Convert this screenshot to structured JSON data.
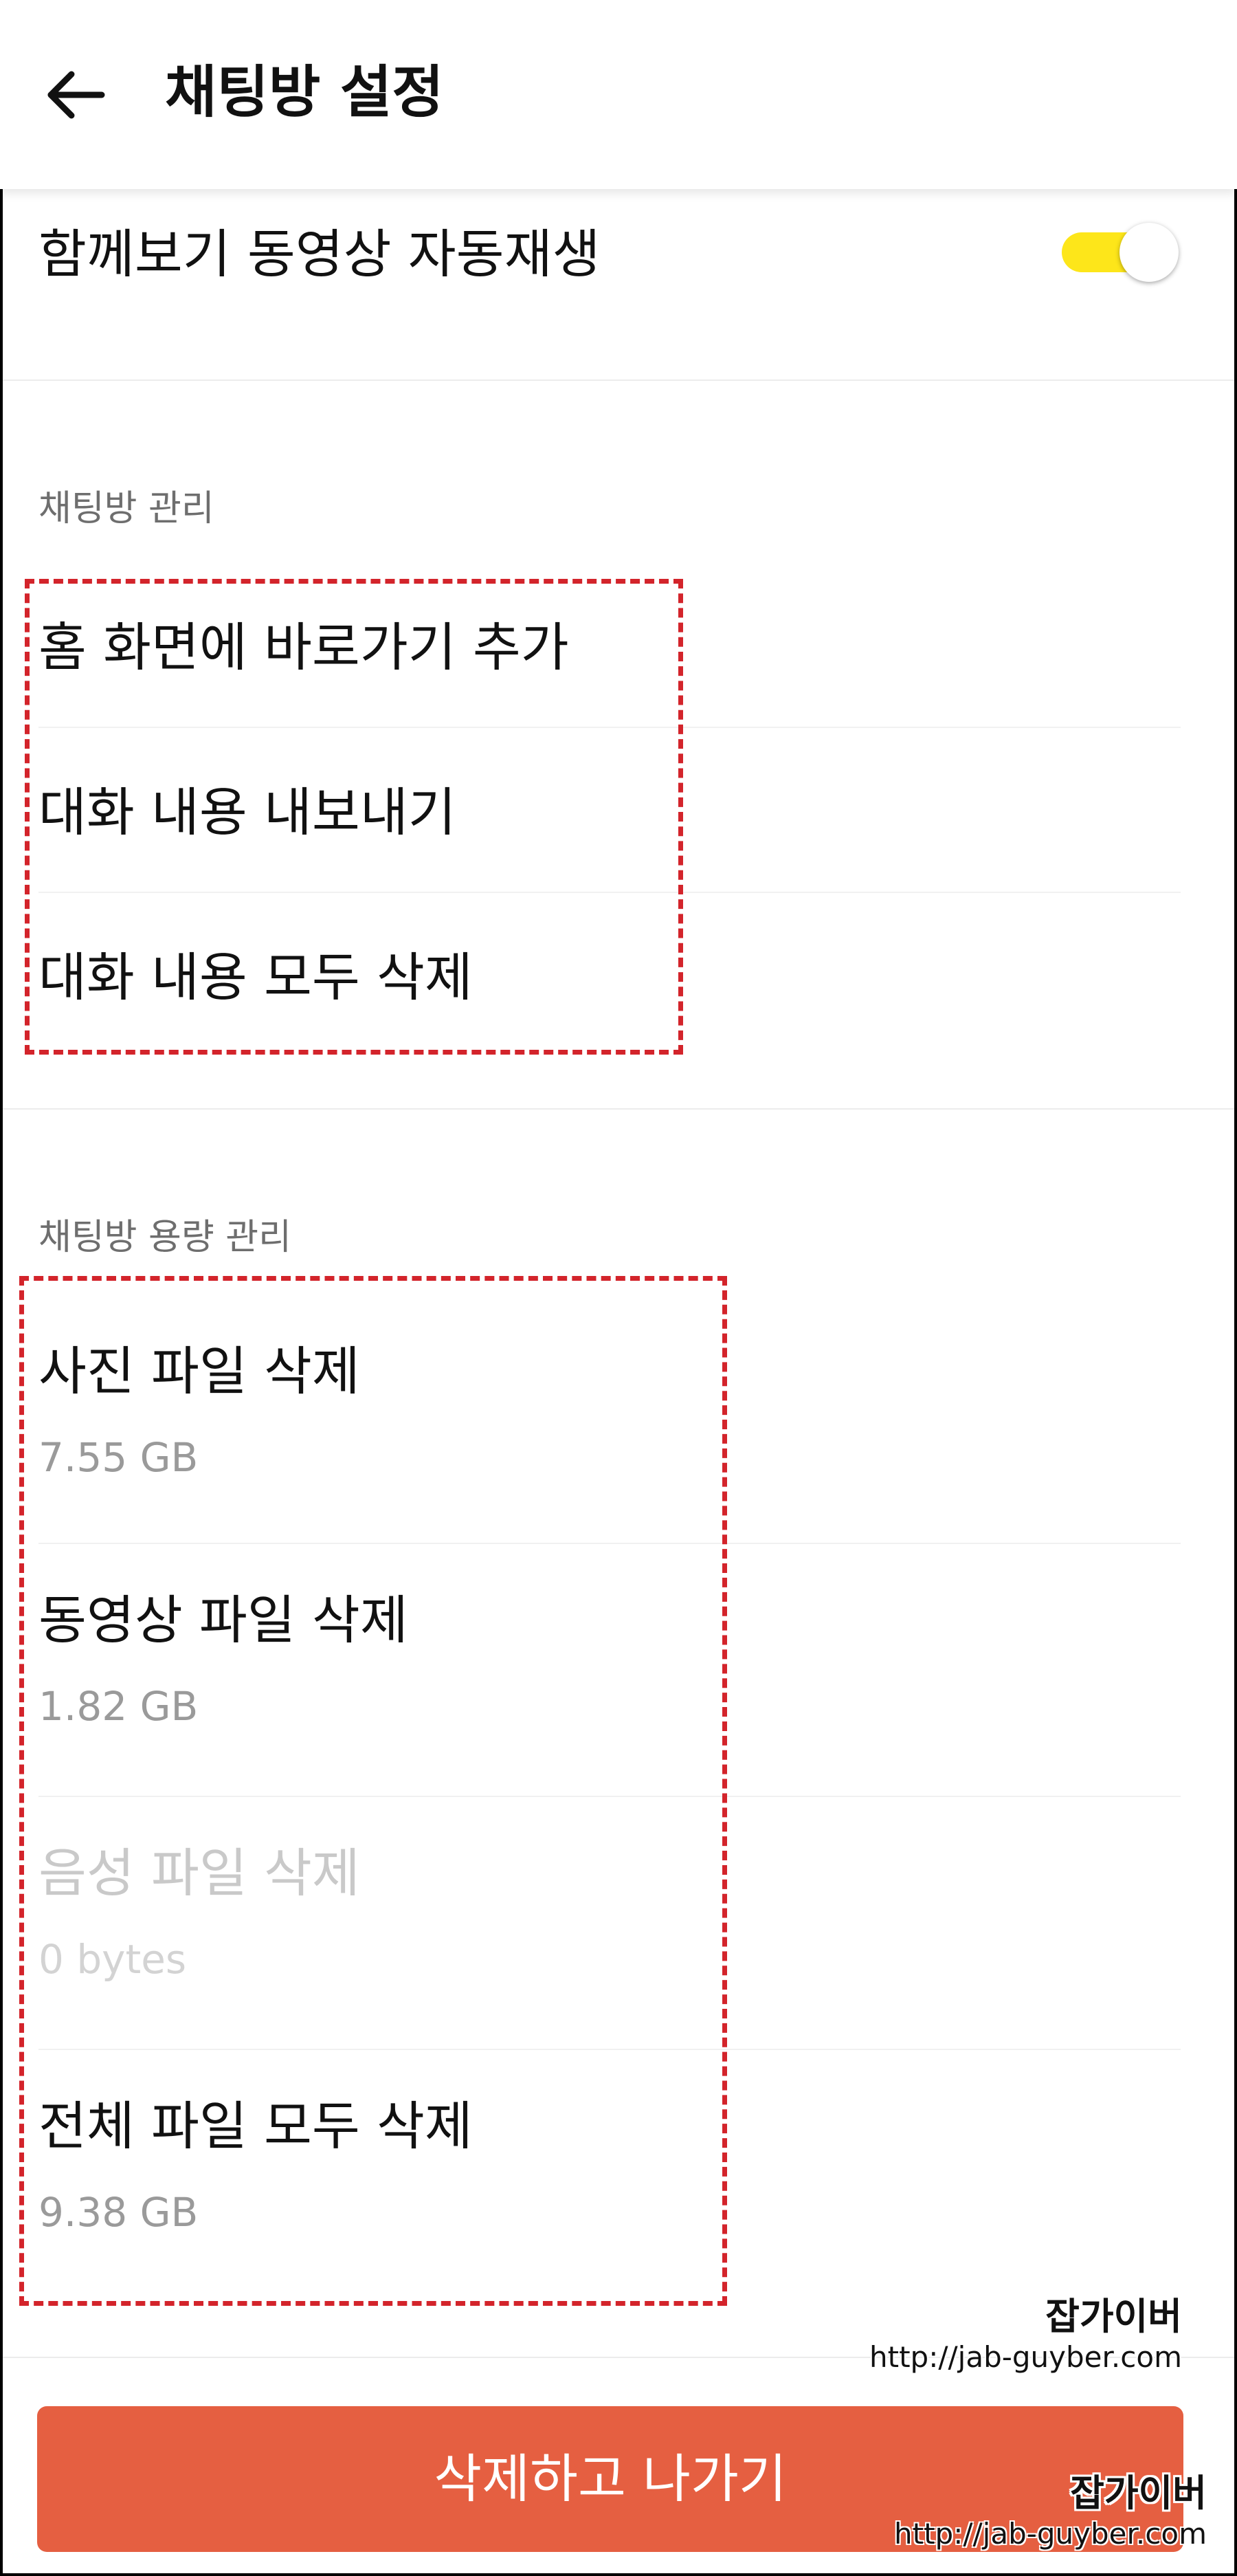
{
  "header": {
    "title": "채팅방 설정",
    "back_icon": "arrow-left-icon"
  },
  "autoplay": {
    "label": "함께보기 동영상 자동재생",
    "enabled": true,
    "toggle_color": "#fde61a"
  },
  "room_management": {
    "section_label": "채팅방 관리",
    "items": [
      {
        "label": "홈 화면에 바로가기 추가"
      },
      {
        "label": "대화 내용 내보내기"
      },
      {
        "label": "대화 내용 모두 삭제"
      }
    ]
  },
  "storage_management": {
    "section_label": "채팅방 용량 관리",
    "items": [
      {
        "label": "사진 파일 삭제",
        "size": "7.55 GB",
        "enabled": true
      },
      {
        "label": "동영상 파일 삭제",
        "size": "1.82 GB",
        "enabled": true
      },
      {
        "label": "음성 파일 삭제",
        "size": "0 bytes",
        "enabled": false
      },
      {
        "label": "전체 파일 모두 삭제",
        "size": "9.38 GB",
        "enabled": true
      }
    ]
  },
  "footer": {
    "leave_button_label": "삭제하고 나가기",
    "button_color": "#e55f41"
  },
  "annotation_color": "#d3242b",
  "watermarks": [
    {
      "title": "잡가이버",
      "url": "http://jab-guyber.com"
    },
    {
      "title": "잡가이버",
      "url": "http://jab-guyber.com"
    }
  ]
}
